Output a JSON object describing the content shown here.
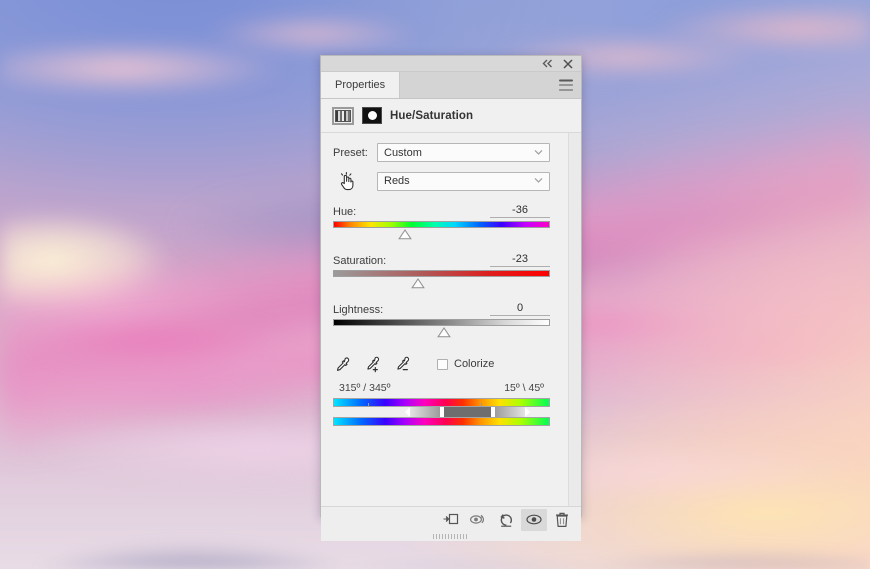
{
  "window": {
    "title_icons": [
      {
        "name": "collapse-icon",
        "glyph": "double-chevron-left"
      },
      {
        "name": "close-icon",
        "glyph": "x"
      }
    ]
  },
  "panel": {
    "tab_label": "Properties",
    "menu_icon": "hamburger-menu-icon",
    "adjustment_title": "Hue/Saturation",
    "thumbnails": [
      {
        "name": "adjustment-thumbnail",
        "selected": true
      },
      {
        "name": "layer-mask-thumbnail",
        "selected": false
      }
    ]
  },
  "preset": {
    "label": "Preset:",
    "value": "Custom",
    "placeholder": "Custom"
  },
  "channel": {
    "tool_icon": "targeted-adjustment-hand-icon",
    "value": "Reds",
    "placeholder": "Reds"
  },
  "sliders": [
    {
      "label": "Hue:",
      "value": "-36",
      "percent": 33,
      "track": "hue"
    },
    {
      "label": "Saturation:",
      "value": "-23",
      "percent": 39,
      "track": "sat"
    },
    {
      "label": "Lightness:",
      "value": "0",
      "percent": 51,
      "track": "light"
    }
  ],
  "tools": {
    "eyedroppers": [
      {
        "name": "eyedropper-icon",
        "mode": "sample"
      },
      {
        "name": "eyedropper-add-icon",
        "mode": "add"
      },
      {
        "name": "eyedropper-subtract-icon",
        "mode": "subtract"
      }
    ],
    "colorize": {
      "label": "Colorize",
      "checked": false
    }
  },
  "color_range": {
    "left_readout": "315º / 345º",
    "right_readout": "15º \\ 45º"
  },
  "footer": {
    "buttons": [
      {
        "name": "clip-to-layer-button",
        "label": "clip-to-layer",
        "active": false
      },
      {
        "name": "view-previous-state-button",
        "label": "view-previous-state",
        "active": false
      },
      {
        "name": "reset-button",
        "label": "reset",
        "active": false
      },
      {
        "name": "toggle-visibility-button",
        "label": "toggle-visibility",
        "active": true
      },
      {
        "name": "delete-adjustment-button",
        "label": "delete-adjustment",
        "active": false
      }
    ]
  },
  "colors": {
    "panel_bg": "#f0f0f0",
    "header_bg": "#d4d4d4",
    "titlebar_bg": "#d8d8d8",
    "text": "#3b3b3b",
    "border": "#b9b9b9",
    "footer_bg": "#eeeeee",
    "active_btn_bg": "#d9d9d9"
  }
}
